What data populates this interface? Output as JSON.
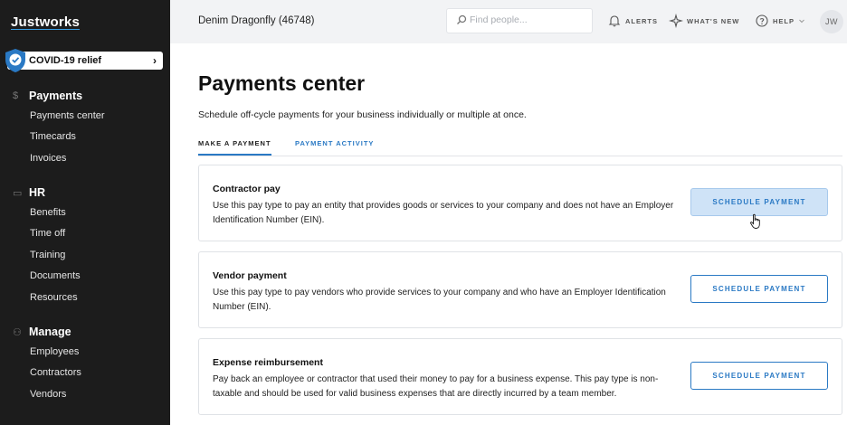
{
  "brand": {
    "logo": "Justworks"
  },
  "covid_banner": {
    "label": "COVID-19 relief",
    "chevron": "›"
  },
  "sidebar": {
    "sections": [
      {
        "icon": "dollar-icon",
        "icon_glyph": "$",
        "title": "Payments",
        "items": [
          "Payments center",
          "Timecards",
          "Invoices"
        ]
      },
      {
        "icon": "briefcase-icon",
        "icon_glyph": "▭",
        "title": "HR",
        "items": [
          "Benefits",
          "Time off",
          "Training",
          "Documents",
          "Resources"
        ]
      },
      {
        "icon": "people-icon",
        "icon_glyph": "⚇",
        "title": "Manage",
        "items": [
          "Employees",
          "Contractors",
          "Vendors"
        ]
      }
    ]
  },
  "topbar": {
    "company": "Denim Dragonfly (46748)",
    "search_placeholder": "Find people...",
    "alerts": "ALERTS",
    "whats_new": "WHAT'S NEW",
    "help": "HELP",
    "avatar_initials": "JW"
  },
  "main": {
    "title": "Payments center",
    "subtitle": "Schedule off-cycle payments for your business individually or multiple at once.",
    "tabs": [
      {
        "label": "MAKE A PAYMENT",
        "active": true
      },
      {
        "label": "PAYMENT ACTIVITY",
        "active": false
      }
    ],
    "cards": [
      {
        "title": "Contractor pay",
        "description": "Use this pay type to pay an entity that provides goods or services to your company and does not have an Employer Identification Number (EIN).",
        "button": "SCHEDULE PAYMENT"
      },
      {
        "title": "Vendor payment",
        "description": "Use this pay type to pay vendors who provide services to your company and who have an Employer Identification Number (EIN).",
        "button": "SCHEDULE PAYMENT"
      },
      {
        "title": "Expense reimbursement",
        "description": "Pay back an employee or contractor that used their money to pay for a business expense. This pay type is non-taxable and should be used for valid business expenses that are directly incurred by a team member.",
        "button": "SCHEDULE PAYMENT"
      }
    ]
  },
  "colors": {
    "sidebar_bg": "#1c1c1c",
    "accent": "#2a79c4",
    "topbar_bg": "#f2f3f5",
    "button_hover_bg": "#cfe3f7"
  }
}
